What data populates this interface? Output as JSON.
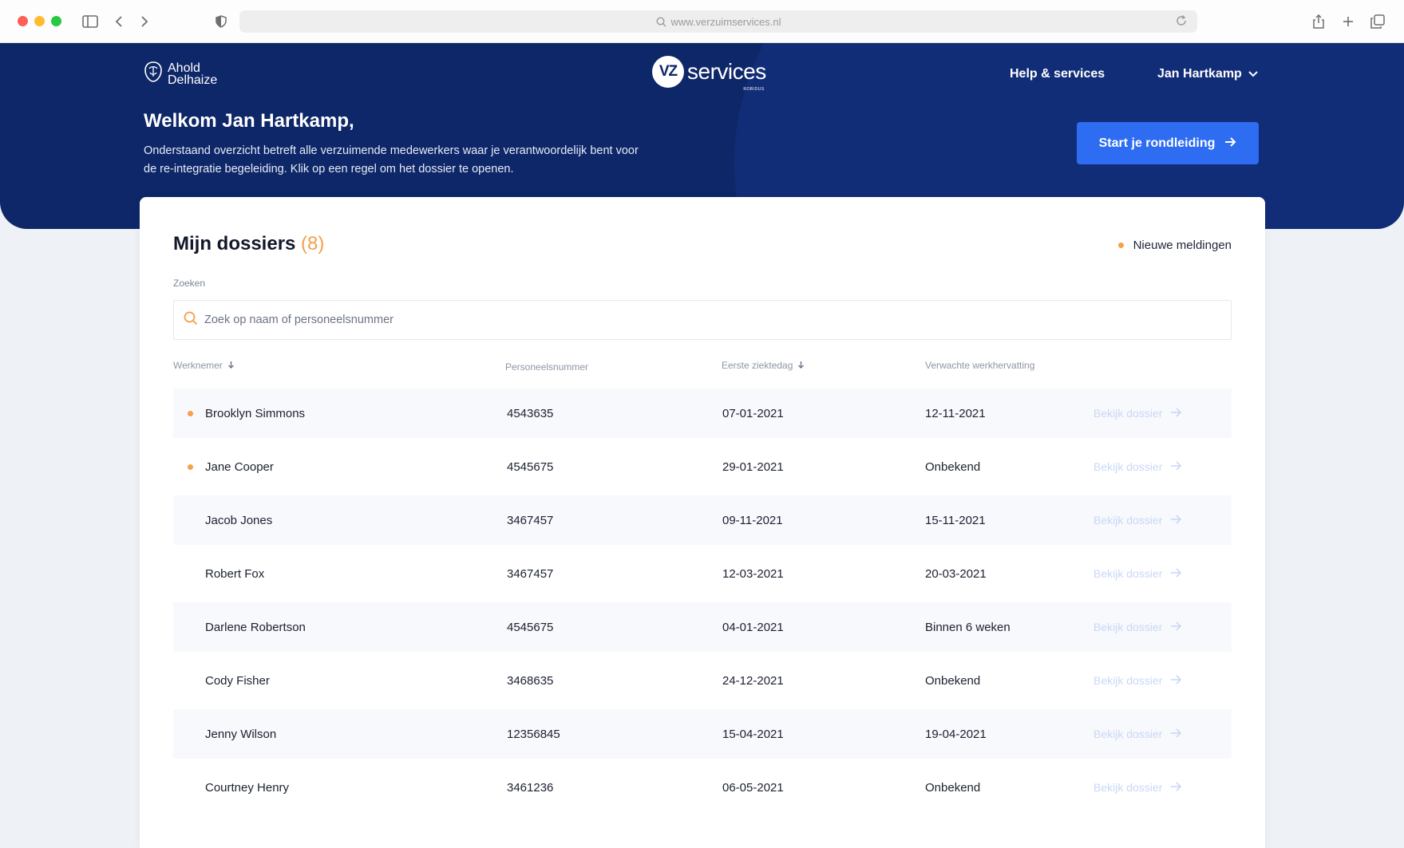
{
  "browser": {
    "url": "www.verzuimservices.nl"
  },
  "header": {
    "brand_left_line1": "Ahold",
    "brand_left_line2": "Delhaize",
    "brand_center_mark": "VZ",
    "brand_center_word": "services",
    "brand_center_sub": "ROBIDUS",
    "nav_help": "Help & services",
    "nav_user": "Jan Hartkamp",
    "welcome": "Welkom Jan Hartkamp,",
    "intro_line1": "Onderstaand overzicht betreft alle verzuimende medewerkers waar je verantwoordelijk bent voor",
    "intro_line2": "de re-integratie begeleiding. Klik op een regel om het dossier te openen.",
    "cta_label": "Start je rondleiding"
  },
  "dossiers": {
    "title": "Mijn dossiers",
    "count": "(8)",
    "legend_label": "Nieuwe meldingen",
    "search_label": "Zoeken",
    "search_placeholder": "Zoek op naam of personeelsnummer",
    "columns": {
      "employee": "Werknemer",
      "number": "Personeelsnummer",
      "first_sick_day": "Eerste ziektedag",
      "expected_return": "Verwachte werkhervatting"
    },
    "action_label": "Bekijk dossier",
    "rows": [
      {
        "name": "Brooklyn Simmons",
        "number": "4543635",
        "first_sick_day": "07-01-2021",
        "expected_return": "12-11-2021",
        "new": true
      },
      {
        "name": "Jane Cooper",
        "number": "4545675",
        "first_sick_day": "29-01-2021",
        "expected_return": "Onbekend",
        "new": true
      },
      {
        "name": "Jacob Jones",
        "number": "3467457",
        "first_sick_day": "09-11-2021",
        "expected_return": "15-11-2021",
        "new": false
      },
      {
        "name": "Robert Fox",
        "number": "3467457",
        "first_sick_day": "12-03-2021",
        "expected_return": "20-03-2021",
        "new": false
      },
      {
        "name": "Darlene Robertson",
        "number": "4545675",
        "first_sick_day": "04-01-2021",
        "expected_return": "Binnen 6 weken",
        "new": false
      },
      {
        "name": "Cody Fisher",
        "number": "3468635",
        "first_sick_day": "24-12-2021",
        "expected_return": "Onbekend",
        "new": false
      },
      {
        "name": "Jenny Wilson",
        "number": "12356845",
        "first_sick_day": "15-04-2021",
        "expected_return": "19-04-2021",
        "new": false
      },
      {
        "name": "Courtney Henry",
        "number": "3461236",
        "first_sick_day": "06-05-2021",
        "expected_return": "Onbekend",
        "new": false
      }
    ]
  },
  "colors": {
    "header_bg": "#0e2768",
    "accent_blue": "#2e6cf2",
    "new_dot": "#f5a04a"
  }
}
